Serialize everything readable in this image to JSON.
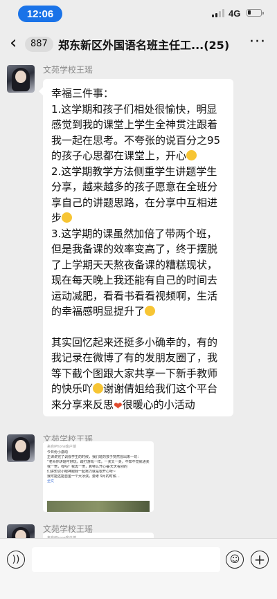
{
  "status": {
    "time": "12:06",
    "network": "4G",
    "battery_level": 0.25
  },
  "nav": {
    "back_icon": "chevron-left-icon",
    "unread_count": "887",
    "title": "郑东新区外国语名班主任工...(25)",
    "more_icon": "ellipsis-icon"
  },
  "messages": [
    {
      "sender": "文苑学校王瑶",
      "lines": [
        "幸福三件事：",
        "1.这学期和孩子们相处很愉快，明显感觉到我的课堂上学生全神贯注跟着我一起在思考。不夸张的说百分之95的孩子心思都在课堂上，开心",
        "2.这学期教学方法侧重学生讲题学生分享，越来越多的孩子愿意在全班分享自己的讲题思路，在分享中互相进步",
        "3.这学期的课虽然加倍了带两个班，但是我备课的效率变高了，终于摆脱了上学期天天熬夜备课的糟糕现状，现在每天晚上我还能有自己的时间去运动减肥，看看书看看视频啊，生活的幸福感明显提升了",
        "",
        "其实回忆起来还挺多小确幸的，有的我记录在微博了有的发朋友圈了，我等下截个图跟大家共享一下新手教师的快乐吖",
        "谢谢倩姐给我们这个平台来分享来反思",
        "很暖心的小活动"
      ]
    },
    {
      "sender": "文苑学校王瑶",
      "card": {
        "head": "来自iPhone客户端",
        "lines": [
          "今日份小激动",
          "正课讲完了调低学生的时候，我们班的孩子突然冒出来一句：",
          "“老师你讲题可好玩，跟打游戏一样，一关又一关，不知不觉就通关了”",
          "我一愣，有吗？我再一愣，真特么开心😂天天看别的",
          "们讲知识小眼神跟我一起努力就是很开心呀~",
          "我可能还能自金一个大冰淇，要考 9月的时候…",
          "全文"
        ]
      }
    },
    {
      "sender": "文苑学校王瑶",
      "card": {
        "head": "来自iPhone客户端",
        "lines": []
      }
    }
  ],
  "input_bar": {
    "voice_icon": "voice-icon",
    "emoji_icon": "emoji-icon",
    "add_icon": "plus-icon"
  }
}
